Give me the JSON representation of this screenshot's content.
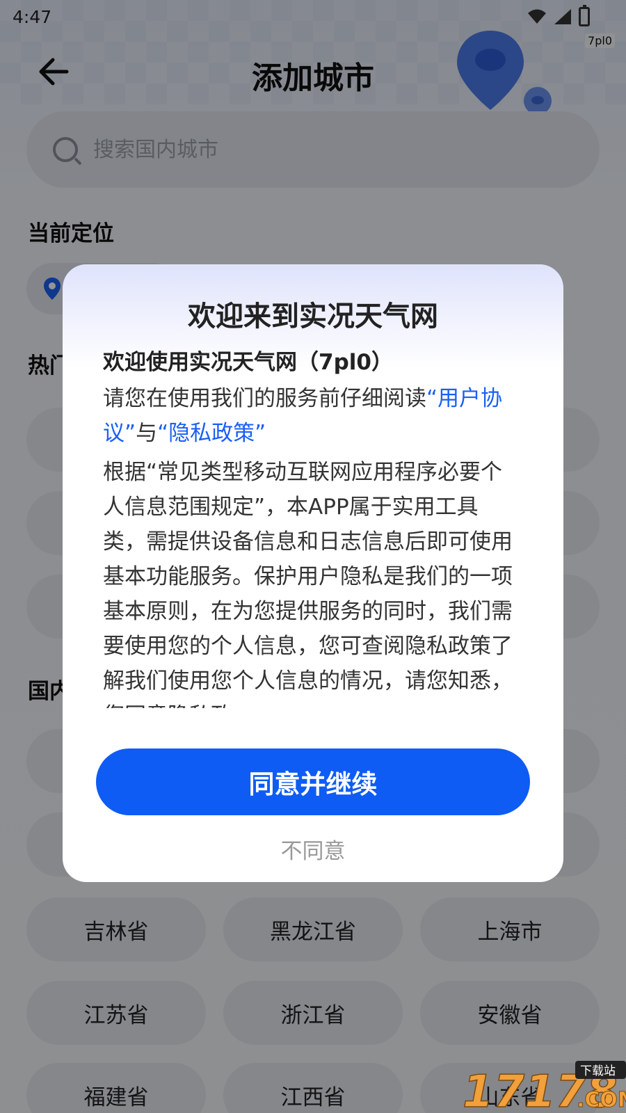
{
  "status_bar": {
    "time": "4:47"
  },
  "watermark_tag": "7pl0",
  "header": {
    "title": "添加城市"
  },
  "search": {
    "placeholder": "搜索国内城市"
  },
  "sections": {
    "current_location": "当前定位",
    "hot": "热门",
    "domestic": "国内"
  },
  "provinces": [
    {
      "label": "吉林省"
    },
    {
      "label": "黑龙江省"
    },
    {
      "label": "上海市"
    },
    {
      "label": "江苏省"
    },
    {
      "label": "浙江省"
    },
    {
      "label": "安徽省"
    },
    {
      "label": "福建省"
    },
    {
      "label": "江西省"
    },
    {
      "label": "山东省"
    }
  ],
  "dialog": {
    "title": "欢迎来到实况天气网",
    "subtitle": "欢迎使用实况天气网（7pl0）",
    "intro_prefix": "请您在使用我们的服务前仔细阅读",
    "user_agreement_link": "“用户协议”",
    "connector": "与",
    "privacy_link": "“隐私政策”",
    "body": "根据“常见类型移动互联网应用程序必要个人信息范围规定”，本APP属于实用工具类，需提供设备信息和日志信息后即可使用基本功能服务。保护用户隐私是我们的一项基本原则，在为您提供服务的同时，我们需要使用您的个人信息，您可查阅隐私政策了解我们使用您个人信息的情况，请您知悉，您同意隐私政",
    "agree_label": "同意并继续",
    "disagree_label": "不同意"
  },
  "corner_logo": {
    "text": "17178",
    "sub": "下载站",
    "domain": ".COM"
  },
  "colors": {
    "accent": "#0f5cf5",
    "link": "#1a5ff5"
  }
}
